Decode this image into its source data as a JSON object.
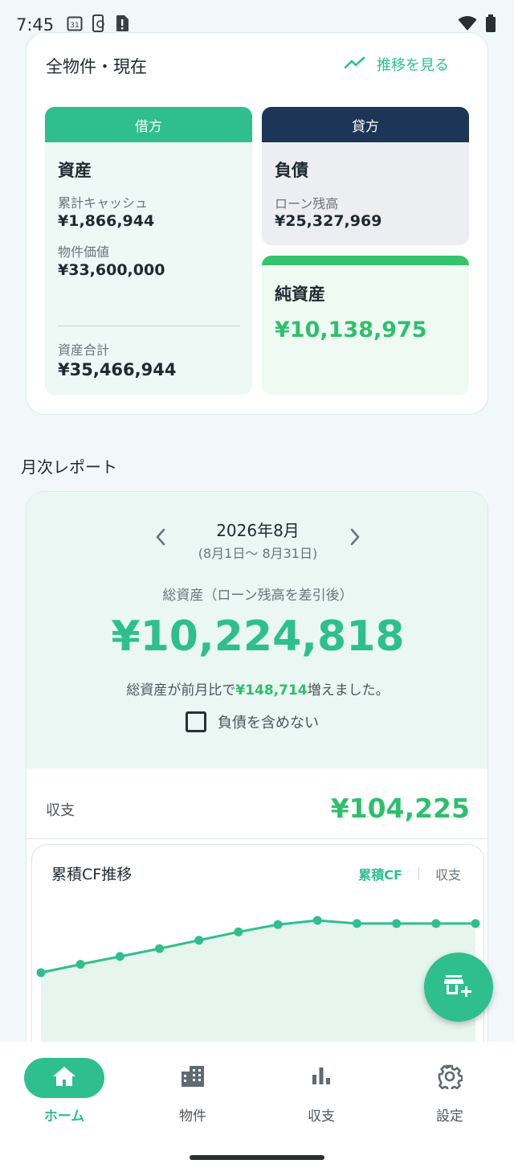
{
  "status_bar": {
    "time": "7:45",
    "calendar_day": "31"
  },
  "summary": {
    "title": "全物件・現在",
    "trend_link": "推移を見る",
    "debit": {
      "header": "借方",
      "heading": "資産",
      "cash_label": "累計キャッシュ",
      "cash_value": "¥1,866,944",
      "property_label": "物件価値",
      "property_value": "¥33,600,000",
      "total_label": "資産合計",
      "total_value": "¥35,466,944"
    },
    "credit": {
      "header": "貸方",
      "heading": "負債",
      "loan_label": "ローン残高",
      "loan_value": "¥25,327,969"
    },
    "net": {
      "heading": "純資産",
      "value": "¥10,138,975"
    }
  },
  "report": {
    "section_title": "月次レポート",
    "month": "2026年8月",
    "range": "(8月1日〜 8月31日)",
    "total_label": "総資産（ローン残高を差引後）",
    "total_value": "¥10,224,818",
    "change_prefix": "総資産が前月比で",
    "change_value": "¥148,714",
    "change_suffix": "増えました。",
    "exclude_debt_label": "負債を含めない",
    "exclude_debt_checked": false,
    "income_label": "収支",
    "income_value": "¥104,225"
  },
  "chart_card": {
    "title": "累積CF推移",
    "tab_active": "累積CF",
    "tab_inactive": "収支"
  },
  "chart_data": {
    "type": "area",
    "title": "累積CF推移",
    "points_relative": [
      0.0,
      0.16,
      0.31,
      0.46,
      0.62,
      0.78,
      0.92,
      1.0,
      0.94,
      0.94,
      0.94,
      0.94
    ],
    "grid": false,
    "color": "#2fbf8f"
  },
  "bottom_nav": {
    "items": [
      {
        "label": "ホーム",
        "icon": "home-icon",
        "active": true
      },
      {
        "label": "物件",
        "icon": "building-icon",
        "active": false
      },
      {
        "label": "収支",
        "icon": "bar-chart-icon",
        "active": false
      },
      {
        "label": "設定",
        "icon": "gear-icon",
        "active": false
      }
    ]
  },
  "colors": {
    "accent": "#2fbf8f",
    "navy": "#1d3557",
    "positive": "#2fbf6c"
  }
}
